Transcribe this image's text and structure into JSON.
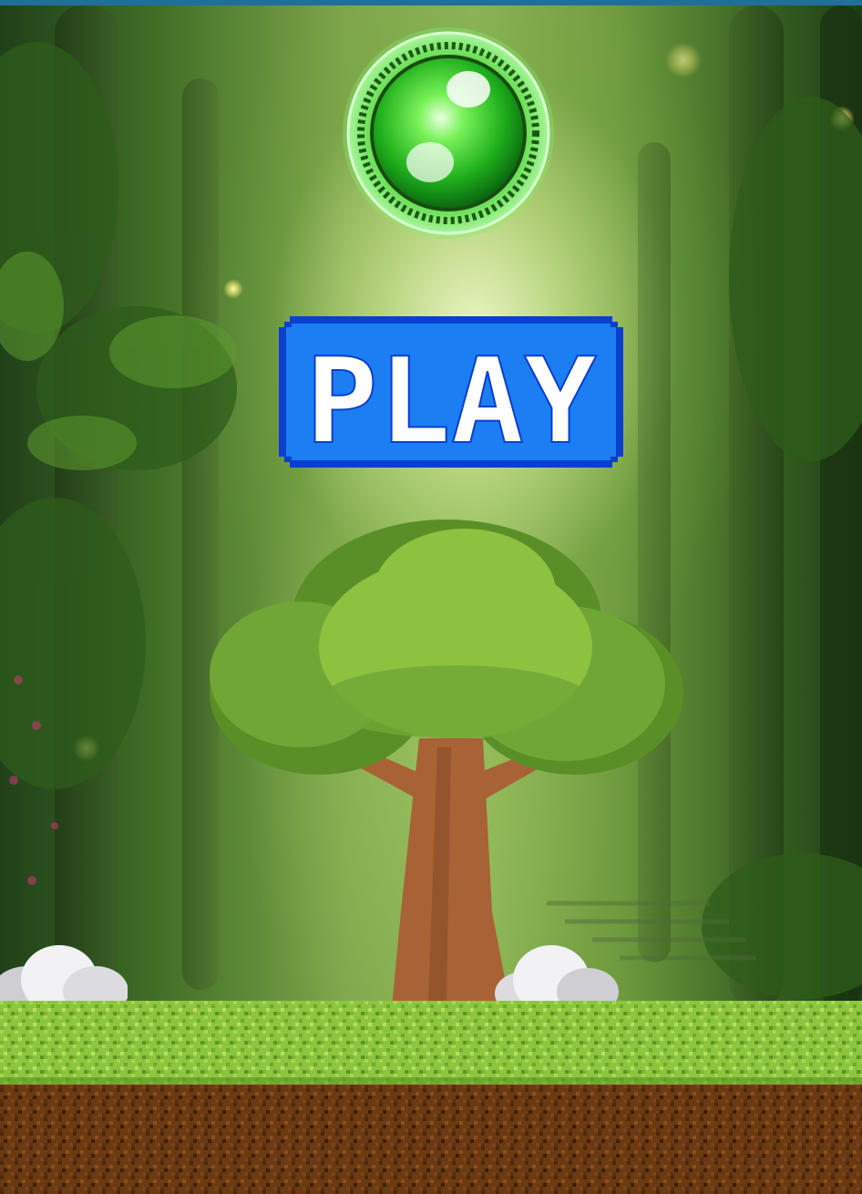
{
  "game": {
    "title": "",
    "play_button": {
      "label": "PLAY"
    },
    "orb": {
      "icon": "green-magic-orb-icon",
      "color": "#3fe03a"
    },
    "scene": {
      "theme": "enchanted forest",
      "tree_icon": "cartoon-tree-icon"
    },
    "colors": {
      "button_fill": "#1b7ef2",
      "button_border": "#0b3fd0",
      "button_text": "#ffffff",
      "grass": "#8cc63f",
      "dirt": "#6b3a12"
    }
  }
}
